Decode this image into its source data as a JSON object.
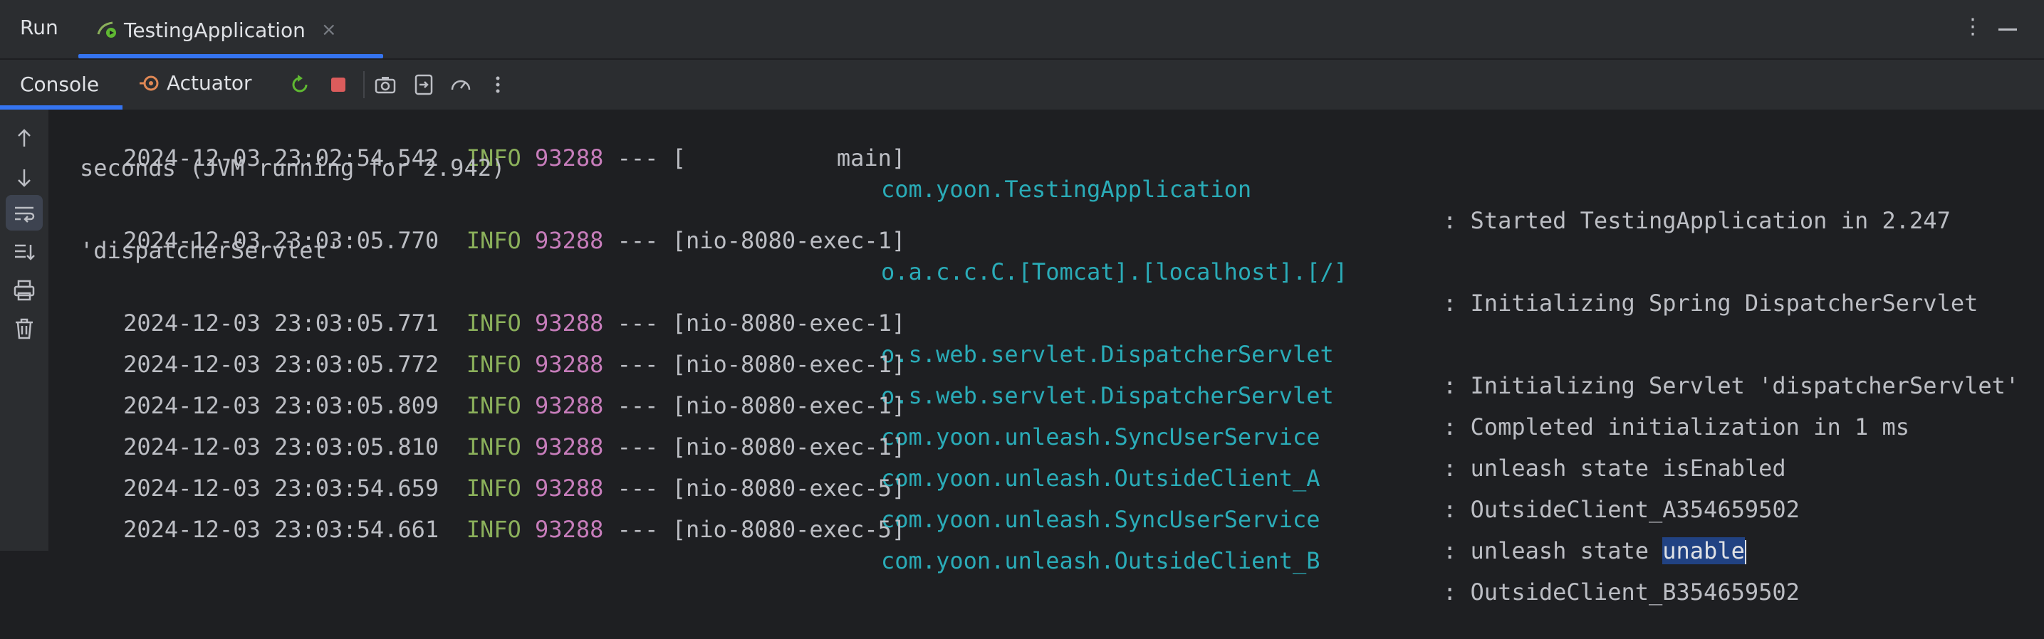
{
  "window": {
    "run_label": "Run",
    "tab_title": "TestingApplication",
    "tab_close": "×",
    "more_options": "⋮"
  },
  "toolbar": {
    "console_tab": "Console",
    "actuator_tab": "Actuator",
    "icons": [
      "rerun-icon",
      "stop-icon",
      "camera-icon",
      "export-icon",
      "gauge-icon",
      "more-icon"
    ]
  },
  "gutter": {
    "icons": [
      "arrow-up-icon",
      "arrow-down-icon",
      "soft-wrap-icon",
      "scroll-to-end-icon",
      "print-icon",
      "trash-icon"
    ]
  },
  "log": [
    {
      "timestamp": "2024-12-03 23:02:54.542",
      "level": "INFO",
      "pid": "93288",
      "sep": "---",
      "thread": "[           main]",
      "logger": "com.yoon.TestingApplication",
      "message": ": Started TestingApplication in 2.247",
      "continuation": "seconds (JVM running for 2.942)"
    },
    {
      "timestamp": "2024-12-03 23:03:05.770",
      "level": "INFO",
      "pid": "93288",
      "sep": "---",
      "thread": "[nio-8080-exec-1]",
      "logger": "o.a.c.c.C.[Tomcat].[localhost].[/]",
      "message": ": Initializing Spring DispatcherServlet",
      "continuation": "'dispatcherServlet'"
    },
    {
      "timestamp": "2024-12-03 23:03:05.771",
      "level": "INFO",
      "pid": "93288",
      "sep": "---",
      "thread": "[nio-8080-exec-1]",
      "logger": "o.s.web.servlet.DispatcherServlet",
      "message": ": Initializing Servlet 'dispatcherServlet'"
    },
    {
      "timestamp": "2024-12-03 23:03:05.772",
      "level": "INFO",
      "pid": "93288",
      "sep": "---",
      "thread": "[nio-8080-exec-1]",
      "logger": "o.s.web.servlet.DispatcherServlet",
      "message": ": Completed initialization in 1 ms"
    },
    {
      "timestamp": "2024-12-03 23:03:05.809",
      "level": "INFO",
      "pid": "93288",
      "sep": "---",
      "thread": "[nio-8080-exec-1]",
      "logger": "com.yoon.unleash.SyncUserService",
      "message": ": unleash state isEnabled"
    },
    {
      "timestamp": "2024-12-03 23:03:05.810",
      "level": "INFO",
      "pid": "93288",
      "sep": "---",
      "thread": "[nio-8080-exec-1]",
      "logger": "com.yoon.unleash.OutsideClient_A",
      "message": ": OutsideClient_A354659502"
    },
    {
      "timestamp": "2024-12-03 23:03:54.659",
      "level": "INFO",
      "pid": "93288",
      "sep": "---",
      "thread": "[nio-8080-exec-5]",
      "logger": "com.yoon.unleash.SyncUserService",
      "message": ": unleash state ",
      "selected": "unable"
    },
    {
      "timestamp": "2024-12-03 23:03:54.661",
      "level": "INFO",
      "pid": "93288",
      "sep": "---",
      "thread": "[nio-8080-exec-5]",
      "logger": "com.yoon.unleash.OutsideClient_B",
      "message": ": OutsideClient_B354659502"
    }
  ],
  "colors": {
    "background": "#1e1f22",
    "panel": "#2b2d30",
    "accent": "#3574f0",
    "info": "#8bb05b",
    "pid": "#c77dbb",
    "logger": "#2aacb8",
    "selection": "#214283"
  }
}
